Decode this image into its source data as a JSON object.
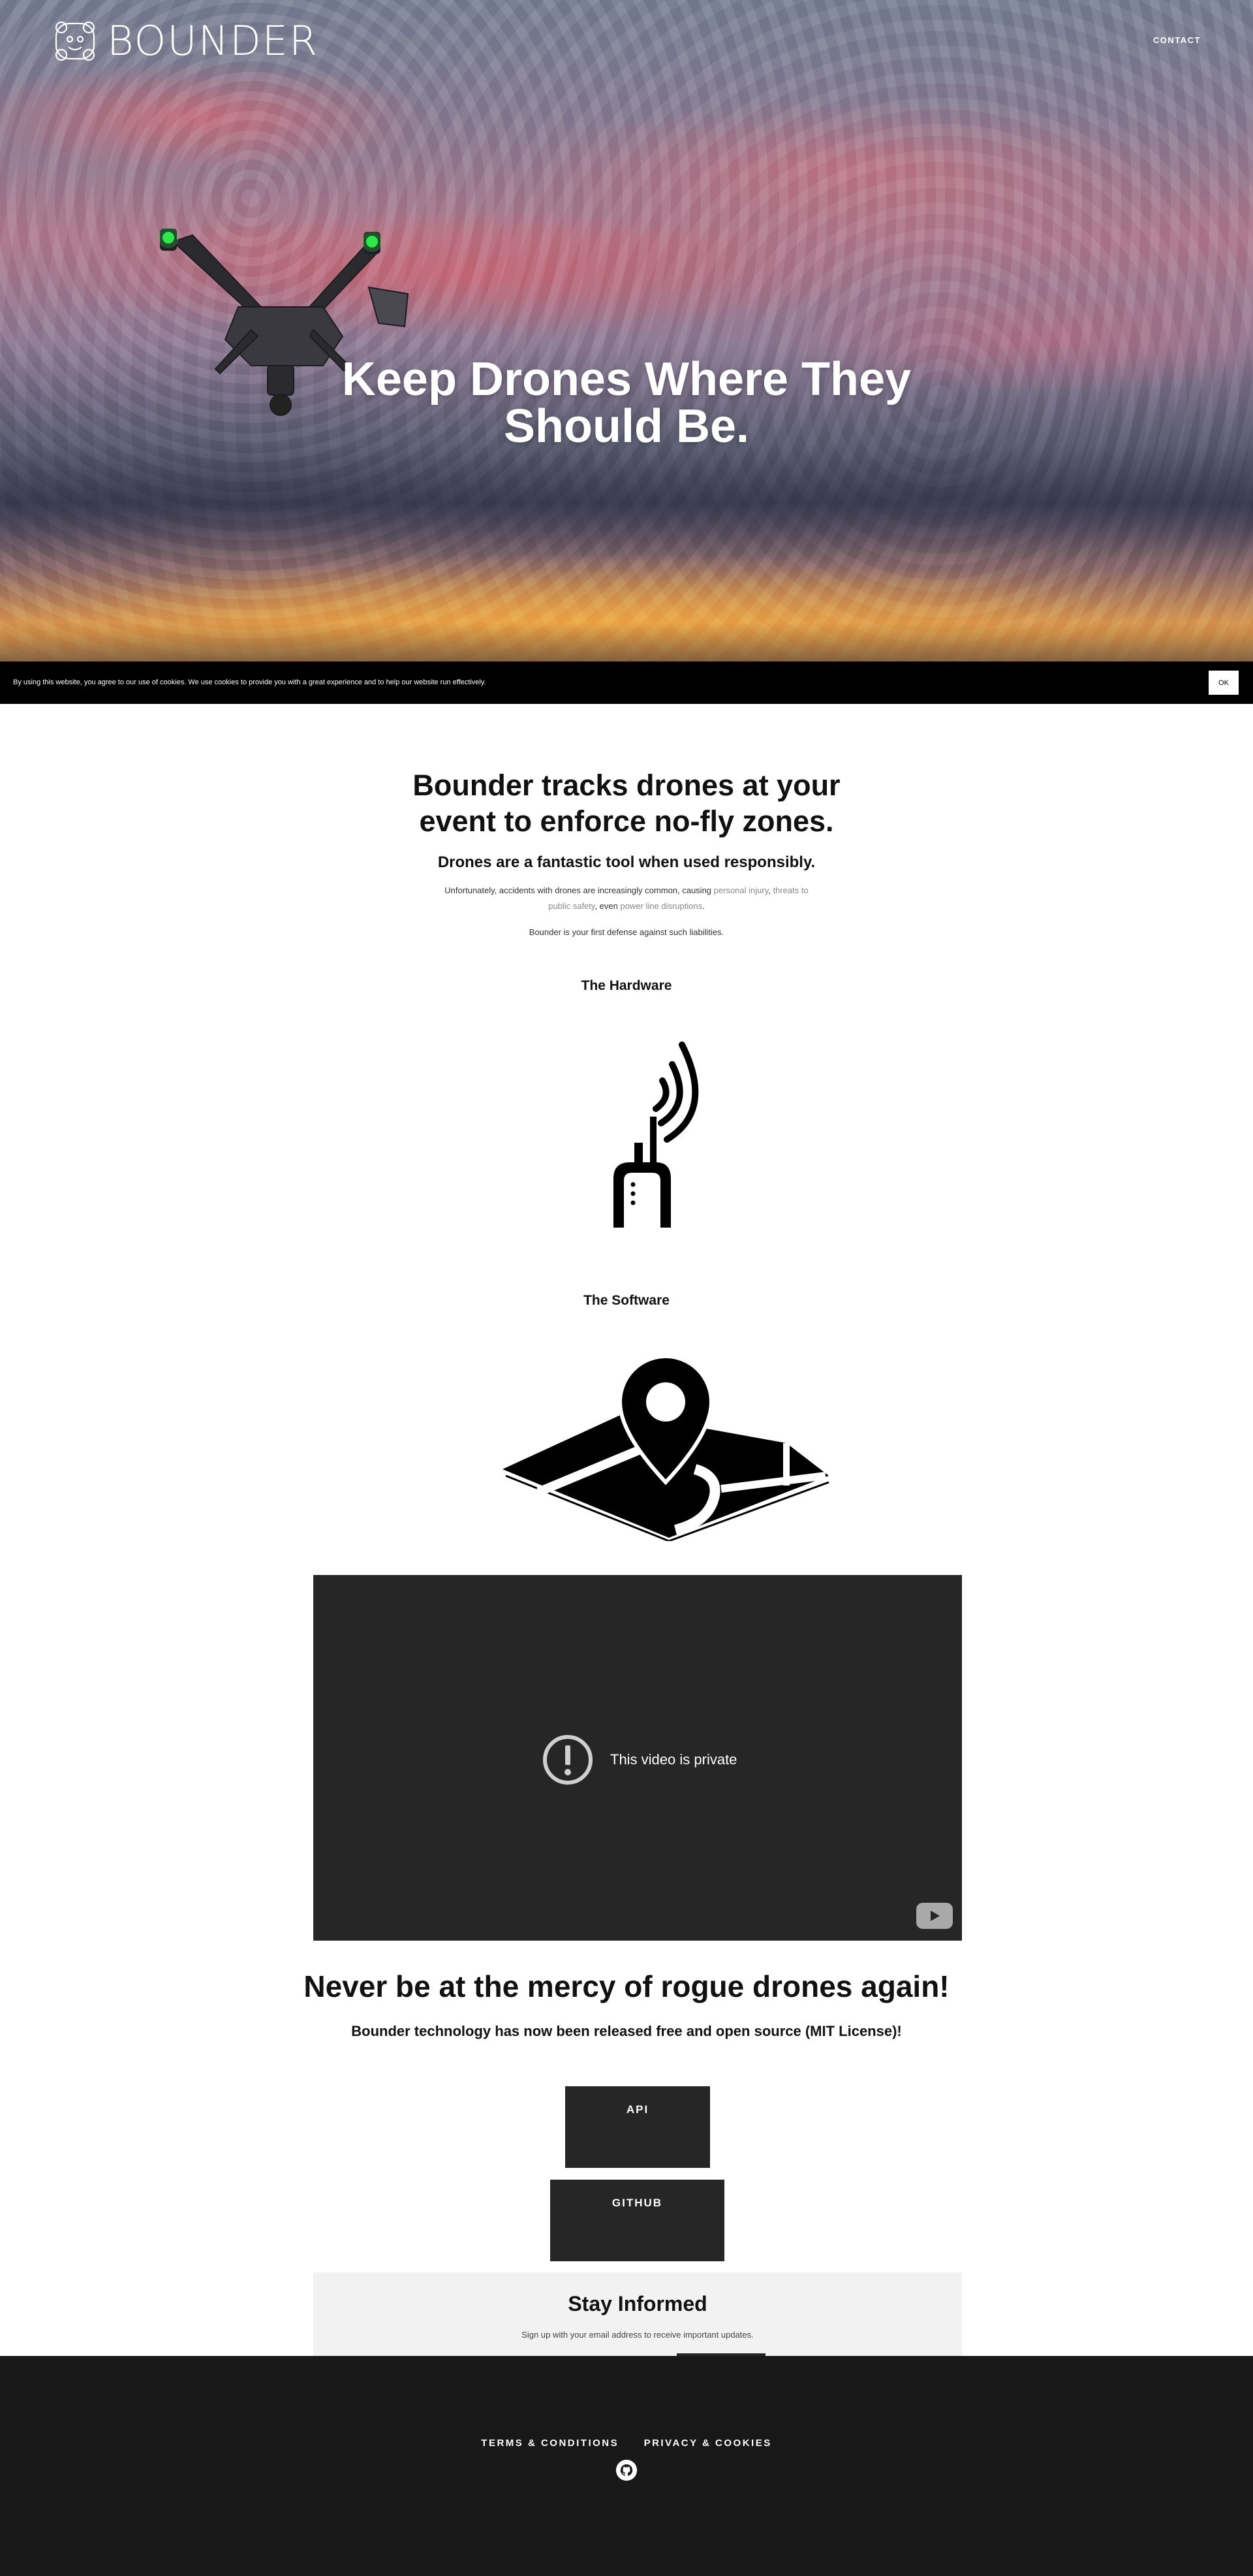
{
  "brand": {
    "name": "BOUNDER",
    "logo_icon": "drone-face-logo-icon"
  },
  "nav": {
    "contact_label": "CONTACT"
  },
  "hero": {
    "title_line1": "Keep Drones Where They",
    "title_line2": "Should Be."
  },
  "cookie_bar": {
    "message": "By using this website, you agree to our use of cookies. We use cookies to provide you with a great experience and to help our website run effectively.",
    "ok_label": "OK"
  },
  "intro": {
    "heading_line1": "Bounder tracks drones at your",
    "heading_line2": "event to enforce no-fly zones.",
    "subheading": "Drones are a fantastic tool when used responsibly.",
    "body_prefix": "Unfortunately, accidents with drones are increasingly common, causing ",
    "link_injury": "personal injury",
    "sep1": ", ",
    "link_safety_1": "threats to",
    "link_safety_2": "public safety",
    "sep2": ", even ",
    "link_power": "power line disruptions",
    "body_suffix": ".",
    "defense": "Bounder is your first defense against such liabilities."
  },
  "hardware": {
    "heading": "The Hardware",
    "icon": "radio-transmitter-icon"
  },
  "software": {
    "heading": "The Software",
    "icon": "map-pin-icon"
  },
  "video": {
    "message": "This video is private",
    "alert_icon": "alert-circle-icon",
    "platform_icon": "youtube-icon"
  },
  "cta": {
    "heading": "Never be at the mercy of rogue drones again!",
    "subheading": "Bounder technology has now been released free and open source (MIT License)!",
    "api_label": "API",
    "github_label": "GITHUB"
  },
  "newsletter": {
    "title": "Stay Informed",
    "text": "Sign up with your email address to receive important updates."
  },
  "footer": {
    "terms_label": "TERMS & CONDITIONS",
    "privacy_label": "PRIVACY & COOKIES",
    "social_icon": "github-icon"
  },
  "colors": {
    "dark": "#262626",
    "footer": "#181818",
    "cookie_bar": "#000000",
    "link_muted": "#888888",
    "signup_bg": "#f2f2f2",
    "drone_light": "#2ee84a"
  }
}
